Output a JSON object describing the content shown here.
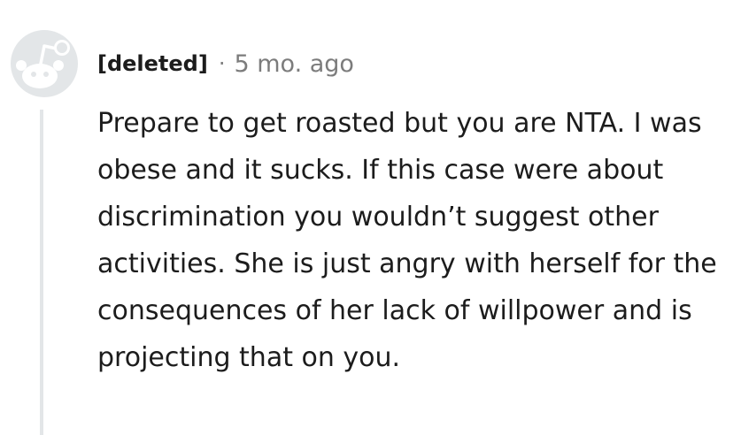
{
  "comment": {
    "author": "[deleted]",
    "separator": "·",
    "timestamp": "5 mo. ago",
    "avatar_icon": "reddit-snoo-default-avatar-icon",
    "body": "Prepare to get roasted but you are NTA. I was obese and it sucks. If this case were about discrimination you wouldn’t suggest other activities. She is just angry with herself for the consequences of her lack of willpower and is projecting that on you."
  },
  "colors": {
    "text": "#1c1c1c",
    "meta": "#7c7c7c",
    "avatar": "#e3e6e8",
    "thread_line": "#e3e6e8",
    "background": "#ffffff"
  }
}
